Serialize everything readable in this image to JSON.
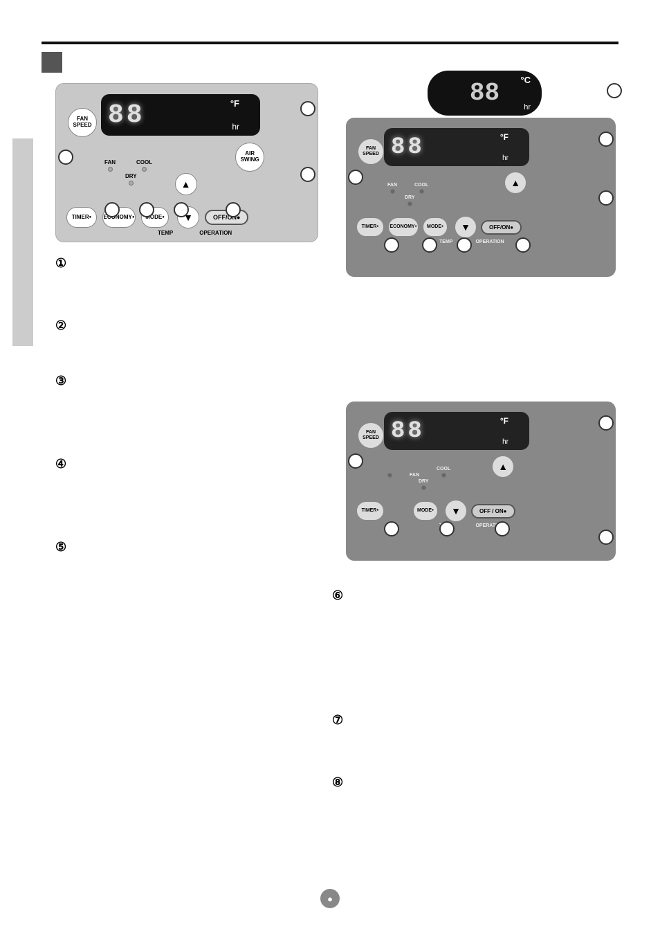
{
  "page": {
    "background": "#ffffff",
    "page_number": "●"
  },
  "top_bar": {
    "color": "#111111"
  },
  "section_tab": {
    "color": "#555555"
  },
  "panel1": {
    "display_digits": "88",
    "unit": "°F",
    "hr_label": "hr",
    "fan_speed_label": "FAN\nSPEED",
    "indicators": [
      "FAN",
      "COOL",
      "DRY"
    ],
    "buttons": [
      "TIMER",
      "ECONOMY",
      "MODE"
    ],
    "temp_label": "TEMP",
    "air_swing_label": "AIR\nSWING",
    "off_on_label": "OFF/ON●",
    "operation_label": "OPERATION"
  },
  "panel2": {
    "celsius_display": "88",
    "celsius_unit": "°C",
    "fahrenheit_display": "88",
    "fahrenheit_unit": "°F",
    "hr_label": "hr",
    "fan_speed_label": "FAN\nSPEED",
    "indicators": [
      "FAN",
      "COOL",
      "DRY"
    ],
    "buttons": [
      "TIMER",
      "ECONOMY",
      "MODE"
    ],
    "temp_label": "TEMP",
    "off_on_label": "OFF/ON●",
    "operation_label": "OPERATION"
  },
  "panel3": {
    "display_digits": "88",
    "unit": "°F",
    "hr_label": "hr",
    "fan_speed_label": "FAN\nSPEED",
    "indicators": [
      "FAN",
      "COOL",
      "DRY"
    ],
    "buttons": [
      "TIMER",
      "MODE"
    ],
    "temp_label": "TEMP",
    "off_on_label": "OFF / ON●",
    "operation_label": "OPERATION"
  },
  "numbered_items": {
    "item1": "①",
    "item2": "②",
    "item3": "③",
    "item4": "④",
    "item5": "⑤",
    "item6": "⑥",
    "item7": "⑦",
    "item8": "⑧"
  },
  "descriptions": {
    "item1": "",
    "item2": "",
    "item3": "",
    "item4": "",
    "item5": "",
    "item6": "",
    "item7": "",
    "item8": ""
  }
}
